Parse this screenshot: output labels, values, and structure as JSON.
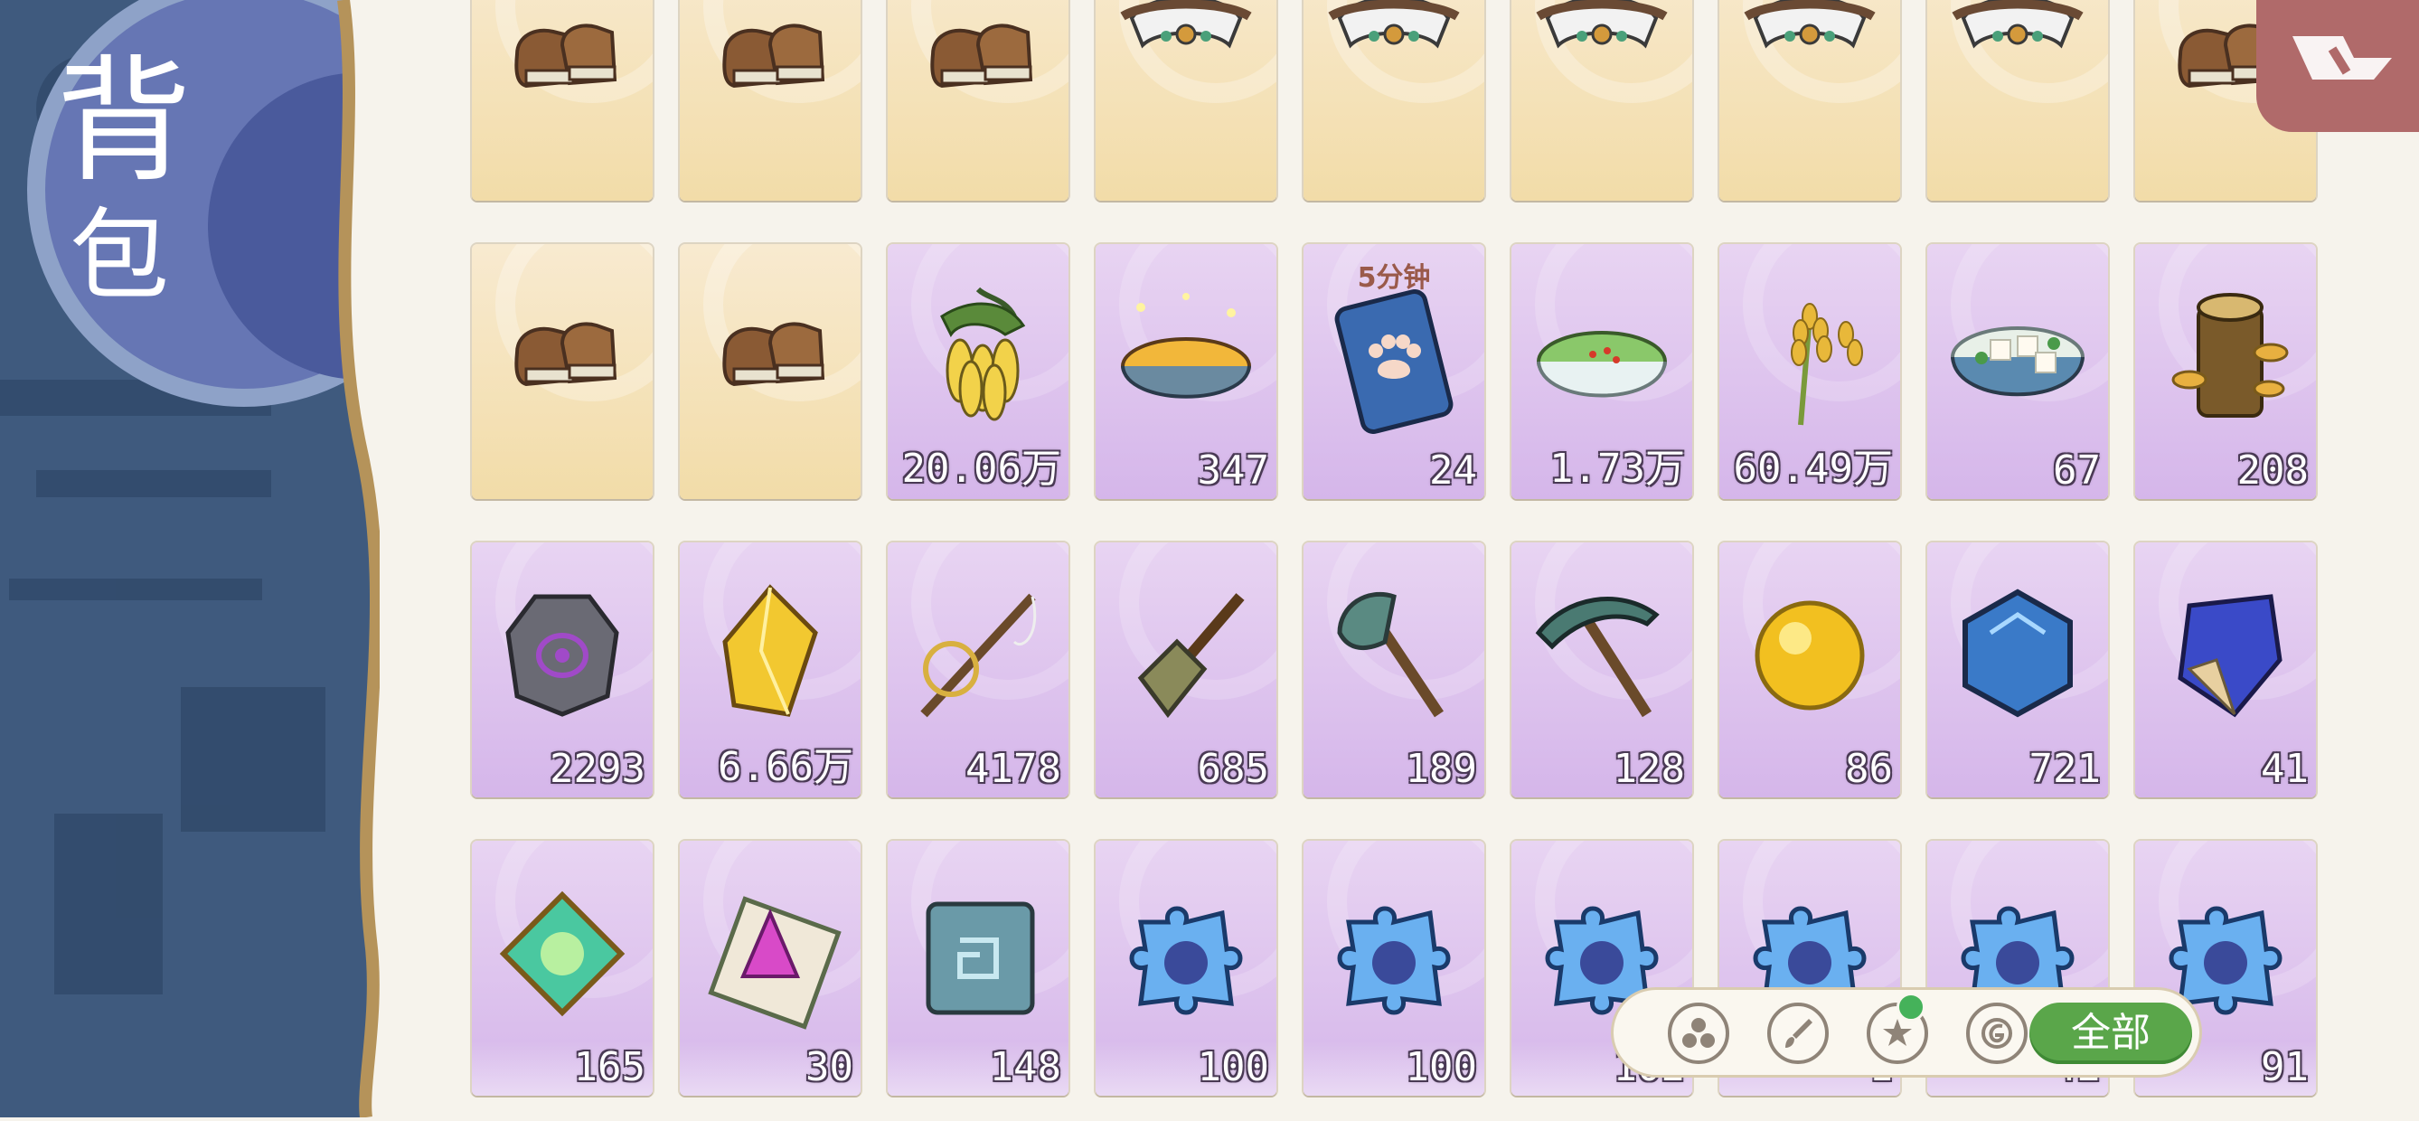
{
  "panel": {
    "title_line1": "背",
    "title_line2": "包"
  },
  "rows": [
    [
      {
        "icon": "leather-boots-icon",
        "bg": "yellow",
        "count": "",
        "timer": ""
      },
      {
        "icon": "leather-boots-icon",
        "bg": "yellow",
        "count": "",
        "timer": ""
      },
      {
        "icon": "leather-boots-icon",
        "bg": "yellow",
        "count": "",
        "timer": ""
      },
      {
        "icon": "fur-collar-icon",
        "bg": "yellow",
        "count": "",
        "timer": ""
      },
      {
        "icon": "fur-collar-icon",
        "bg": "yellow",
        "count": "",
        "timer": ""
      },
      {
        "icon": "fur-collar-icon",
        "bg": "yellow",
        "count": "",
        "timer": ""
      },
      {
        "icon": "fur-collar-icon",
        "bg": "yellow",
        "count": "",
        "timer": ""
      },
      {
        "icon": "fur-collar-icon",
        "bg": "yellow",
        "count": "",
        "timer": ""
      },
      {
        "icon": "leather-boots-icon",
        "bg": "yellow",
        "count": "",
        "timer": ""
      }
    ],
    [
      {
        "icon": "leather-boots-icon",
        "bg": "yellow",
        "count": "",
        "timer": ""
      },
      {
        "icon": "leather-boots-icon",
        "bg": "yellow",
        "count": "",
        "timer": ""
      },
      {
        "icon": "banana-bunch-icon",
        "bg": "purple",
        "count": "20.06万",
        "timer": ""
      },
      {
        "icon": "corn-soup-icon",
        "bg": "purple",
        "count": "347",
        "timer": ""
      },
      {
        "icon": "paw-card-icon",
        "bg": "purple",
        "count": "24",
        "timer": "5分钟"
      },
      {
        "icon": "vegetable-soup-icon",
        "bg": "purple",
        "count": "1.73万",
        "timer": ""
      },
      {
        "icon": "wheat-icon",
        "bg": "purple",
        "count": "60.49万",
        "timer": ""
      },
      {
        "icon": "tofu-soup-icon",
        "bg": "purple",
        "count": "67",
        "timer": ""
      },
      {
        "icon": "mushroom-log-icon",
        "bg": "purple",
        "count": "208",
        "timer": ""
      }
    ],
    [
      {
        "icon": "stone-ore-icon",
        "bg": "purple",
        "count": "2293",
        "timer": ""
      },
      {
        "icon": "yellow-crystal-icon",
        "bg": "purple",
        "count": "6.66万",
        "timer": ""
      },
      {
        "icon": "fishing-rod-icon",
        "bg": "purple",
        "count": "4178",
        "timer": ""
      },
      {
        "icon": "shovel-icon",
        "bg": "purple",
        "count": "685",
        "timer": ""
      },
      {
        "icon": "axe-icon",
        "bg": "purple",
        "count": "189",
        "timer": ""
      },
      {
        "icon": "pickaxe-icon",
        "bg": "purple",
        "count": "128",
        "timer": ""
      },
      {
        "icon": "gold-orb-icon",
        "bg": "purple",
        "count": "86",
        "timer": ""
      },
      {
        "icon": "blue-hex-gem-icon",
        "bg": "purple",
        "count": "721",
        "timer": ""
      },
      {
        "icon": "blue-crystal-icon",
        "bg": "purple",
        "count": "41",
        "timer": ""
      }
    ],
    [
      {
        "icon": "green-gem-tile-icon",
        "bg": "purple",
        "count": "165",
        "timer": ""
      },
      {
        "icon": "pink-crystal-tile-icon",
        "bg": "purple",
        "count": "30",
        "timer": ""
      },
      {
        "icon": "stone-rune-tile-icon",
        "bg": "purple",
        "count": "148",
        "timer": ""
      },
      {
        "icon": "puzzle-piece-icon",
        "bg": "purple",
        "count": "100",
        "timer": ""
      },
      {
        "icon": "puzzle-piece-icon",
        "bg": "purple",
        "count": "100",
        "timer": ""
      },
      {
        "icon": "puzzle-piece-icon",
        "bg": "purple",
        "count": "102",
        "timer": ""
      },
      {
        "icon": "puzzle-piece-icon",
        "bg": "purple",
        "count": "1",
        "timer": ""
      },
      {
        "icon": "puzzle-piece-icon",
        "bg": "purple",
        "count": "42",
        "timer": ""
      },
      {
        "icon": "puzzle-piece-icon",
        "bg": "purple",
        "count": "91",
        "timer": ""
      }
    ]
  ],
  "filters": {
    "icons": [
      "cluster-icon",
      "brush-icon",
      "star-badge-icon",
      "coin-icon"
    ],
    "all_label": "全部"
  },
  "colors": {
    "panel_blue": "#5b6aa6",
    "close_red": "#b06a6a",
    "filter_green": "#5aa64a"
  }
}
